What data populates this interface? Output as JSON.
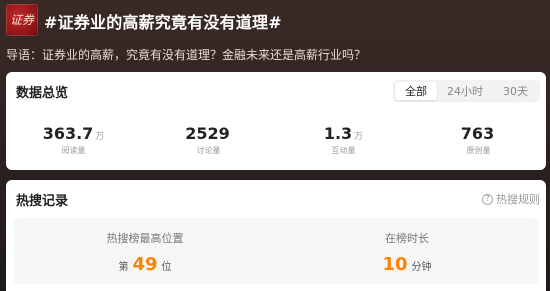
{
  "header": {
    "logo_text": "证券",
    "title": "#证券业的高薪究竟有没有道理#"
  },
  "guide": "导语：证券业的高薪，究竟有没有道理？金融未来还是高薪行业吗？",
  "overview": {
    "title": "数据总览",
    "tabs": [
      {
        "label": "全部",
        "active": true
      },
      {
        "label": "24小时",
        "active": false
      },
      {
        "label": "30天",
        "active": false
      }
    ],
    "stats": [
      {
        "value": "363.7",
        "unit": "万",
        "label": "阅读量"
      },
      {
        "value": "2529",
        "unit": "",
        "label": "讨论量"
      },
      {
        "value": "1.3",
        "unit": "万",
        "label": "互动量"
      },
      {
        "value": "763",
        "unit": "",
        "label": "原创量"
      }
    ]
  },
  "hot": {
    "title": "热搜记录",
    "rule_label": "热搜规则",
    "peak": {
      "label": "热搜榜最高位置",
      "prefix": "第",
      "value": "49",
      "suffix": "位"
    },
    "duration": {
      "label": "在榜时长",
      "value": "10",
      "unit": "分钟"
    }
  },
  "colors": {
    "accent": "#ff8200",
    "background": "#2e2422",
    "card": "#ffffff"
  }
}
